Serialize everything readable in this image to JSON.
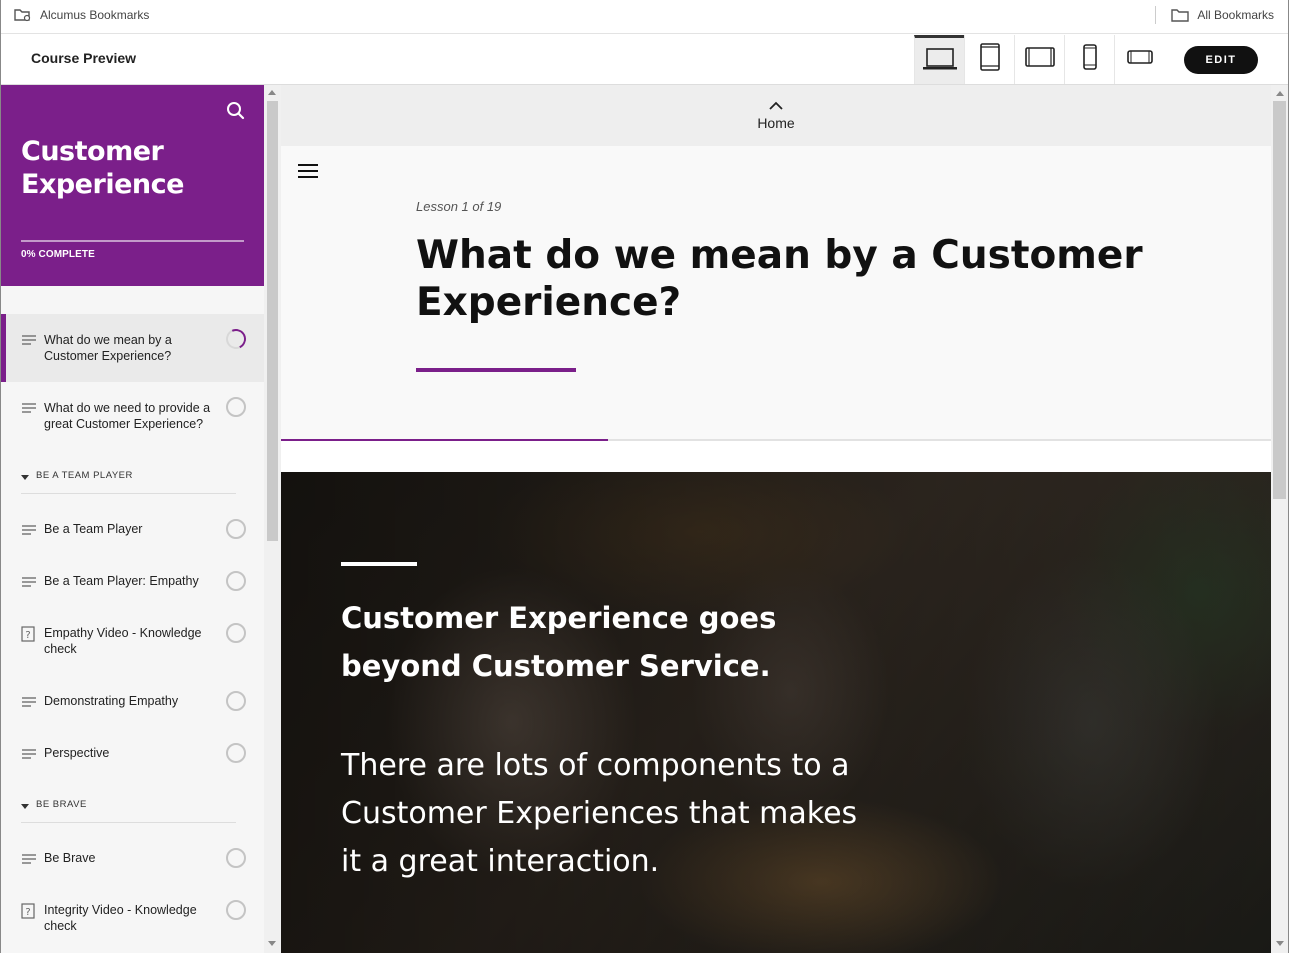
{
  "bookmarks": {
    "left_label": "Alcumus Bookmarks",
    "right_label": "All Bookmarks"
  },
  "app_bar": {
    "title": "Course Preview",
    "devices": [
      {
        "name": "desktop",
        "active": true
      },
      {
        "name": "tablet-portrait",
        "active": false
      },
      {
        "name": "tablet-landscape",
        "active": false
      },
      {
        "name": "phone-portrait",
        "active": false
      },
      {
        "name": "phone-landscape",
        "active": false
      }
    ],
    "edit_label": "EDIT"
  },
  "sidebar": {
    "course_title": "Customer Experience",
    "progress_label": "0% COMPLETE",
    "lessons": [
      {
        "label": "What do we mean by a Customer Experience?",
        "icon": "text-lines-icon",
        "status": "in-progress"
      },
      {
        "label": "What do we need to provide a great Customer Experience?",
        "icon": "text-lines-icon",
        "status": "not-started"
      }
    ],
    "sections": [
      {
        "label": "BE A TEAM PLAYER",
        "lessons": [
          {
            "label": "Be a Team Player",
            "icon": "text-lines-icon",
            "status": "not-started"
          },
          {
            "label": "Be a Team Player: Empathy",
            "icon": "text-lines-icon",
            "status": "not-started"
          },
          {
            "label": "Empathy Video - Knowledge check",
            "icon": "question-icon",
            "status": "not-started"
          },
          {
            "label": "Demonstrating Empathy",
            "icon": "text-lines-icon",
            "status": "not-started"
          },
          {
            "label": "Perspective",
            "icon": "text-lines-icon",
            "status": "not-started"
          }
        ]
      },
      {
        "label": "BE BRAVE",
        "lessons": [
          {
            "label": "Be Brave",
            "icon": "text-lines-icon",
            "status": "not-started"
          },
          {
            "label": "Integrity Video - Knowledge check",
            "icon": "question-icon",
            "status": "not-started"
          }
        ]
      }
    ]
  },
  "main": {
    "home_label": "Home",
    "lesson_counter": "Lesson 1 of 19",
    "lesson_title": "What do we mean by a Customer Experience?",
    "lesson_progress": 0.33,
    "image_heading": "Customer Experience goes beyond Customer Service.",
    "image_body": "There are lots of components to a Customer Experiences that makes it a great interaction."
  },
  "colors": {
    "brand": "#7b1f8a",
    "edit_button": "#111111",
    "sidebar_bg": "#f6f6f6"
  }
}
